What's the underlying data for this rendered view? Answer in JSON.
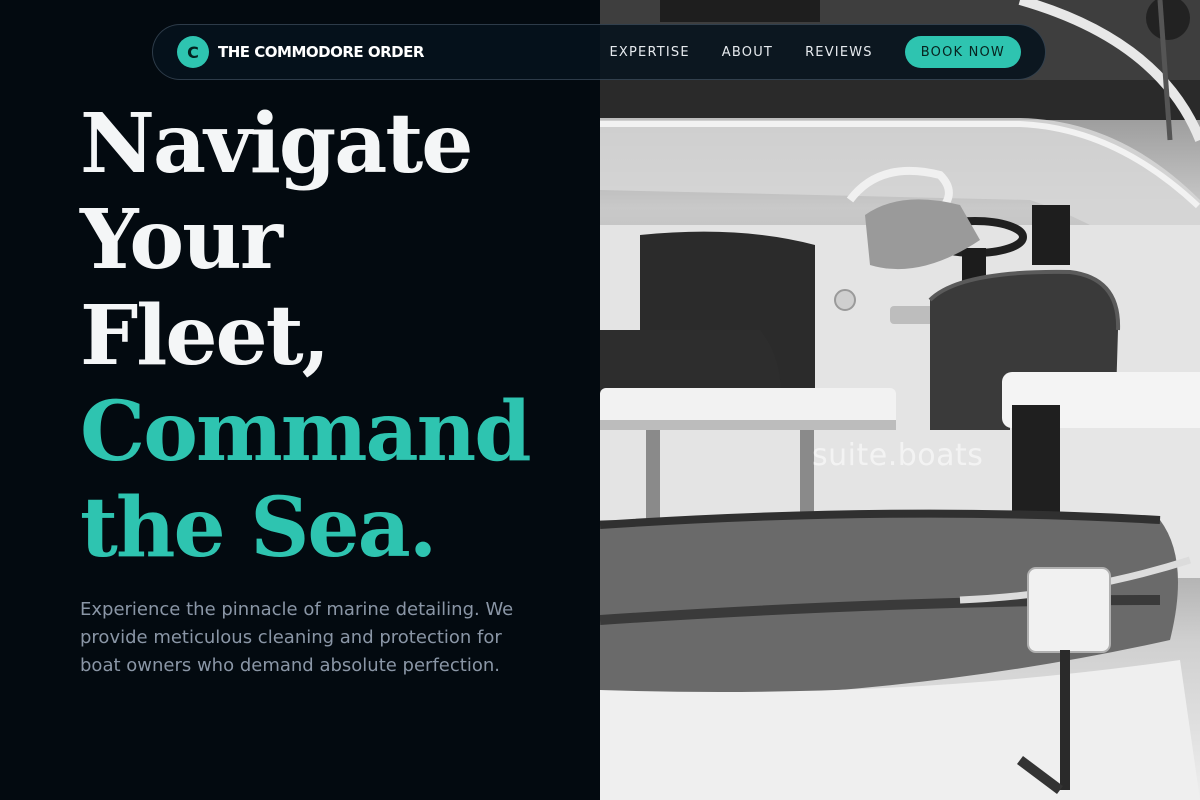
{
  "colors": {
    "background": "#030a10",
    "accent": "#2ec4b0",
    "headline_white": "#f4f6f7",
    "subtext": "#8a96a6"
  },
  "nav": {
    "logo_letter": "C",
    "brand": "THE COMMODORE ORDER",
    "links": [
      "EXPERTISE",
      "ABOUT",
      "REVIEWS"
    ],
    "cta": "BOOK NOW"
  },
  "hero": {
    "headline_lines": [
      "Navigate",
      "Your",
      "Fleet,"
    ],
    "headline_accent_lines": [
      "Command",
      "the Sea."
    ],
    "description": "Experience the pinnacle of marine detailing. We provide meticulous cleaning and protection for boat owners who demand absolute perfection."
  },
  "image": {
    "icon": "boat-interior-photo",
    "watermark": "suite.boats"
  }
}
